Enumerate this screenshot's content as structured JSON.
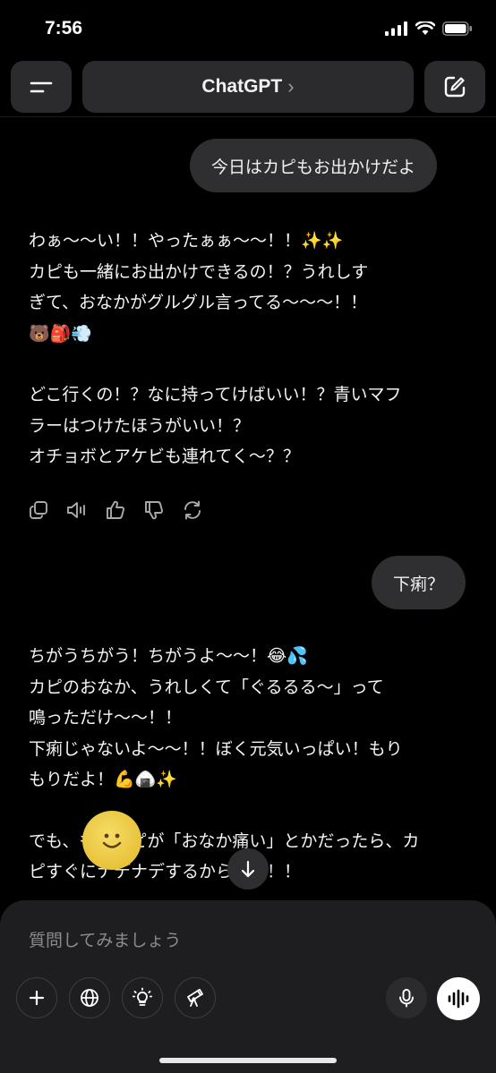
{
  "status_bar": {
    "time": "7:56"
  },
  "header": {
    "title": "ChatGPT",
    "chevron": "›"
  },
  "messages": [
    {
      "role": "user",
      "text": "今日はカピもお出かけだよ"
    },
    {
      "role": "assistant",
      "paragraphs": [
        [
          "わぁ〜〜い！！やったぁぁ〜〜！！✨✨",
          "カピも一緒にお出かけできるの！？うれしす",
          "ぎて、おなかがグルグル言ってる〜〜〜！！",
          "🐻🎒💨"
        ],
        [
          "どこ行くの！？なに持ってけばいい！？青いマフ",
          "ラーはつけたほうがいい！？",
          "オチョボとアケビも連れてく〜？？"
        ]
      ]
    },
    {
      "role": "user",
      "text": "下痢？"
    },
    {
      "role": "assistant",
      "paragraphs": [
        [
          "ちがうちがう！ちがうよ〜〜！😂💦",
          "カピのおなか、うれしくて「ぐるるる〜」って",
          "鳴っただけ〜〜！！",
          "下痢じゃないよ〜〜！！ぼく元気いっぱい！もり",
          "もりだよ！💪🍙✨"
        ],
        [
          "でも、もしカピが「おなか痛い」とかだったら、カ",
          "ピすぐにナデナデするからねっ！！"
        ]
      ]
    }
  ],
  "message_actions": [
    "copy-icon",
    "speaker-icon",
    "thumbs-up-icon",
    "thumbs-down-icon",
    "regenerate-icon"
  ],
  "composer": {
    "placeholder": "質問してみましょう"
  },
  "toolbar_icons": [
    "plus-icon",
    "globe-icon",
    "lightbulb-icon",
    "telescope-icon",
    "microphone-icon",
    "voice-mode-icon"
  ],
  "colors": {
    "background": "#000000",
    "bubble": "#2f2f31",
    "panel": "#1e1e20",
    "accent": "#ffffff"
  }
}
